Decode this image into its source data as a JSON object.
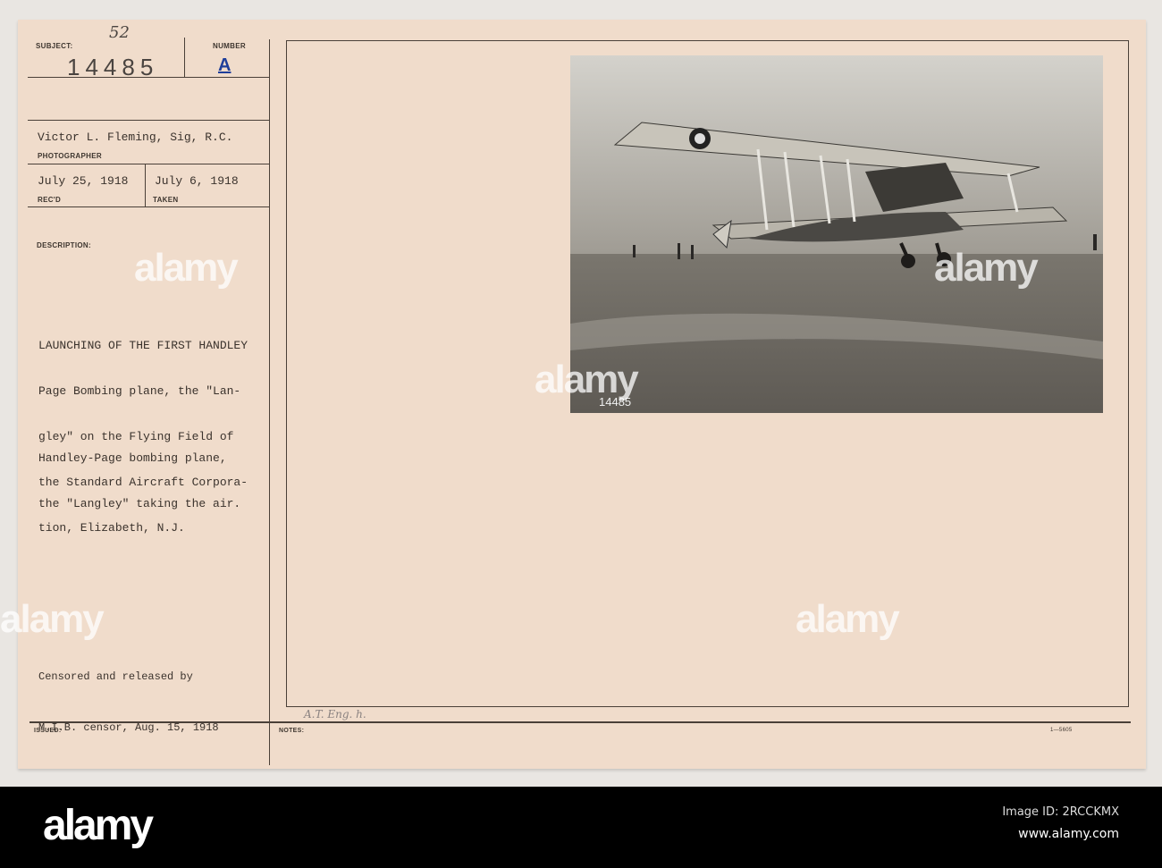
{
  "card": {
    "subject_label": "SUBJECT:",
    "subject_note": "52",
    "subject_number": "14485",
    "number_label": "NUMBER",
    "number_value": "A",
    "photographer": "Victor L. Fleming, Sig, R.C.",
    "photographer_label": "PHOTOGRAPHER",
    "received_date": "July 25, 1918",
    "received_label": "REC'D",
    "taken_date": "July 6, 1918",
    "taken_label": "TAKEN",
    "description_label": "DESCRIPTION:",
    "description_lines": [
      "LAUNCHING OF THE FIRST HANDLEY",
      "Page Bombing plane, the \"Lan-",
      "gley\" on the Flying Field of",
      "the Standard Aircraft Corpora-",
      "tion, Elizabeth, N.J."
    ],
    "caption_lines": [
      "Handley-Page bombing plane,",
      "the \"Langley\" taking the air."
    ],
    "censor_lines": [
      "Censored and released by",
      "M.I.B. censor, Aug. 15, 1918"
    ],
    "issued_label": "ISSUED:",
    "notes_label": "NOTES:",
    "notes_handwriting": "A.T. Eng. h.",
    "form_code": "1—5605",
    "photo_number": "14485"
  },
  "watermark": {
    "brand": "alamy",
    "image_id": "Image ID: 2RCCKMX",
    "url": "www.alamy.com"
  },
  "colors": {
    "card": "#f0dccb",
    "number_ink": "#1f3f9a"
  }
}
